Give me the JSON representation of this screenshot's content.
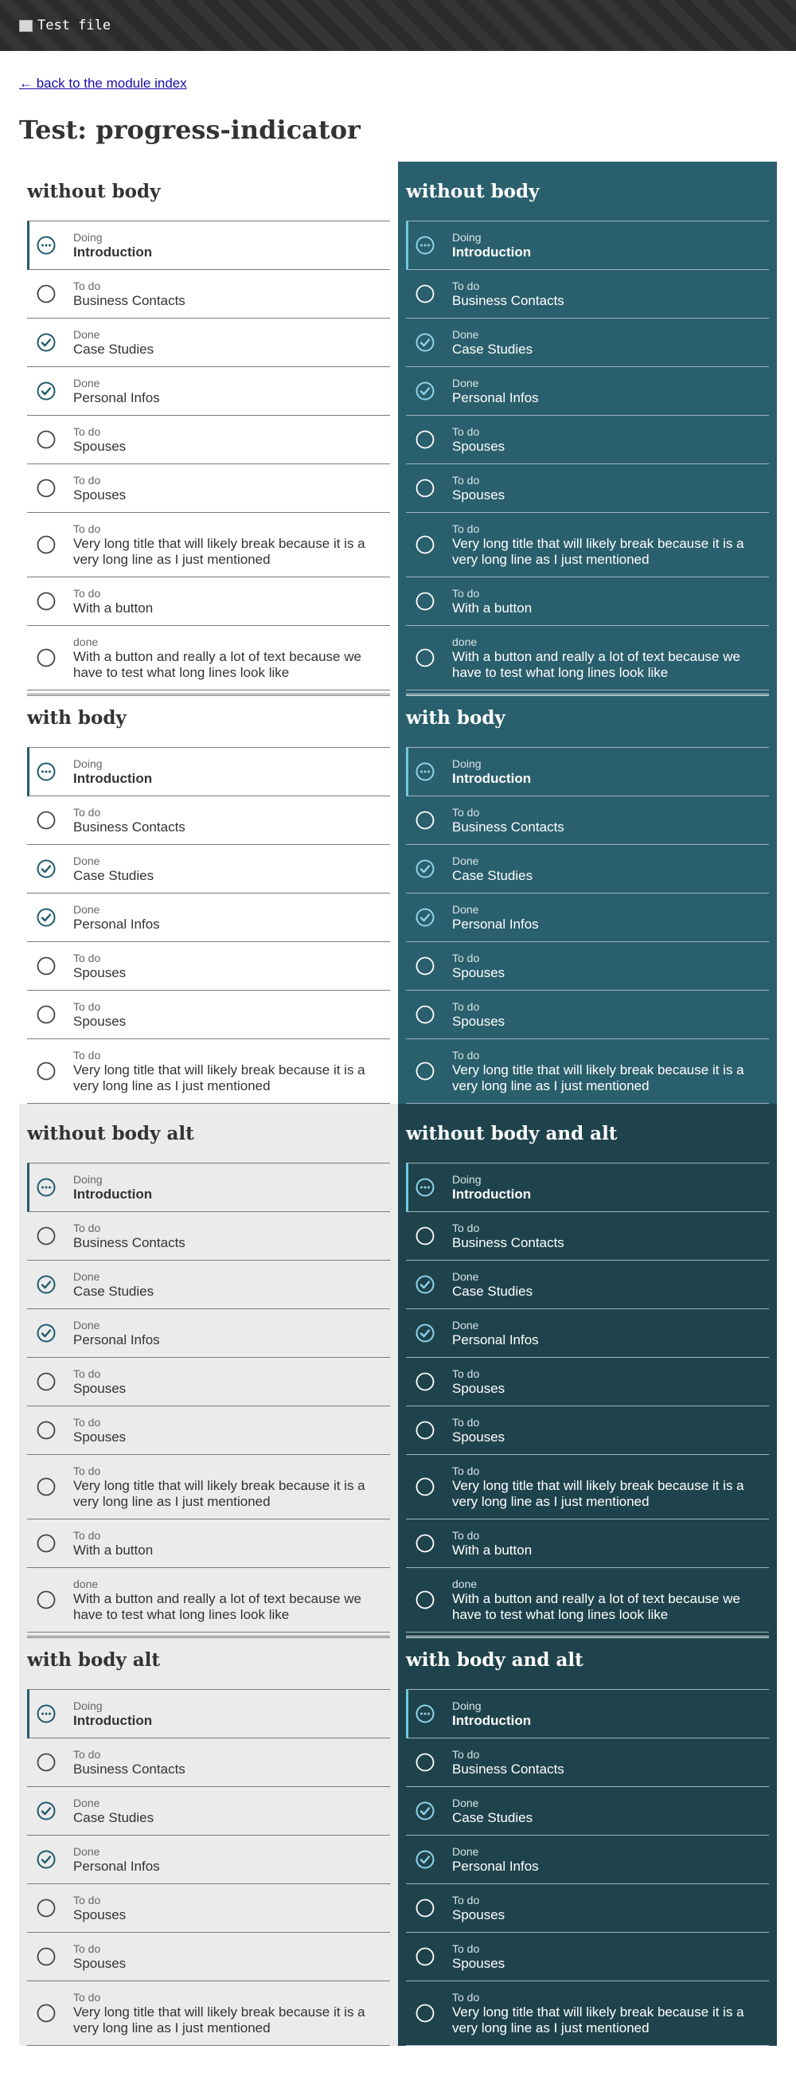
{
  "header": {
    "title": "Test file",
    "icon": "file-icon"
  },
  "back_link": "← back to the module index",
  "page_title": "Test: progress-indicator",
  "colors": {
    "dark_panel": "#2a5f6d",
    "darker_panel": "#1f434c",
    "grey_panel": "#ebebeb",
    "accent": "#1f5b6c",
    "accent_light": "#6fc8e6"
  },
  "full_list": [
    {
      "status": "Doing",
      "title": "Introduction",
      "state": "doing"
    },
    {
      "status": "To do",
      "title": "Business Contacts",
      "state": "todo"
    },
    {
      "status": "Done",
      "title": "Case Studies",
      "state": "done"
    },
    {
      "status": "Done",
      "title": "Personal Infos",
      "state": "done"
    },
    {
      "status": "To do",
      "title": "Spouses",
      "state": "todo"
    },
    {
      "status": "To do",
      "title": "Spouses",
      "state": "todo"
    },
    {
      "status": "To do",
      "title": "Very long title that will likely break because it is a very long line as I just mentioned",
      "state": "todo",
      "tall": true
    },
    {
      "status": "To do",
      "title": "With a button",
      "state": "todo"
    },
    {
      "status": "done",
      "title": "With a button and really a lot of text because we have to test what long lines look like",
      "state": "todo",
      "tall": true
    }
  ],
  "body_list": [
    {
      "status": "Doing",
      "title": "Introduction",
      "state": "doing"
    },
    {
      "status": "To do",
      "title": "Business Contacts",
      "state": "todo"
    },
    {
      "status": "Done",
      "title": "Case Studies",
      "state": "done"
    },
    {
      "status": "Done",
      "title": "Personal Infos",
      "state": "done"
    },
    {
      "status": "To do",
      "title": "Spouses",
      "state": "todo"
    },
    {
      "status": "To do",
      "title": "Spouses",
      "state": "todo"
    },
    {
      "status": "To do",
      "title": "Very long title that will likely break because it is a very long line as I just mentioned",
      "state": "todo",
      "tall": true
    }
  ],
  "panels": [
    {
      "theme": "light",
      "sections": [
        {
          "title": "without body",
          "list": "full_list"
        },
        {
          "title": "with body",
          "list": "body_list"
        }
      ]
    },
    {
      "theme": "dark",
      "sections": [
        {
          "title": "without body",
          "list": "full_list"
        },
        {
          "title": "with body",
          "list": "body_list"
        }
      ]
    },
    {
      "theme": "grey",
      "sections": [
        {
          "title": "without body alt",
          "list": "full_list"
        },
        {
          "title": "with body alt",
          "list": "body_list"
        }
      ]
    },
    {
      "theme": "darker",
      "sections": [
        {
          "title": "without body and alt",
          "list": "full_list"
        },
        {
          "title": "with body and alt",
          "list": "body_list"
        }
      ]
    }
  ]
}
